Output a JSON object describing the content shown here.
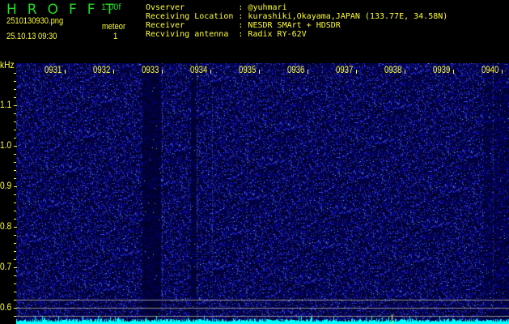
{
  "header": {
    "app_title": "HROFFT",
    "version": "1.00f",
    "filename": "2510130930.png",
    "datetime": "25.10.13 09:30",
    "meteor_label": "meteor",
    "meteor_count": "1"
  },
  "info": [
    {
      "label": "Ovserver           ",
      "value": ": @yuhmari"
    },
    {
      "label": "Receiving Location ",
      "value": ": kurashiki,Okayama,JAPAN (133.77E, 34.58N)"
    },
    {
      "label": "Receiver           ",
      "value": ": NESDR SMArt + HDSDR"
    },
    {
      "label": "Recviving antenna  ",
      "value": ": Radix RY-62V"
    }
  ],
  "axis": {
    "unit": "kHz",
    "y_labels": [
      "1.1",
      "1.0",
      "0.9",
      "0.8",
      "0.7",
      "0.6"
    ],
    "time_labels": [
      "0931",
      "0932",
      "0933",
      "0934",
      "0935",
      "0936",
      "0937",
      "0938",
      "0939",
      "0940"
    ]
  },
  "colors": {
    "text": "#ffff33",
    "title": "#22dd22",
    "noise": "#00ffff"
  }
}
